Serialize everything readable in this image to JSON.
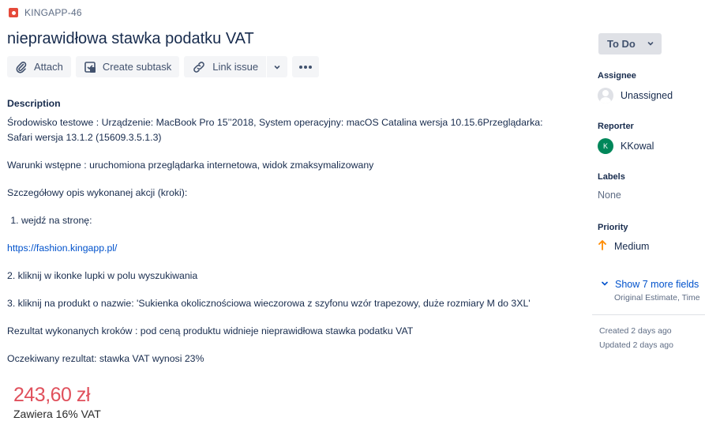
{
  "issue": {
    "key": "KINGAPP-46",
    "title": "nieprawidłowa stawka podatku VAT"
  },
  "toolbar": {
    "attach": "Attach",
    "create_subtask": "Create subtask",
    "link_issue": "Link issue"
  },
  "description": {
    "heading": "Description",
    "env_line1": "Środowisko testowe : Urządzenie: MacBook Pro 15’’2018, System operacyjny: macOS Catalina wersja 10.15.6Przeglądarka:",
    "env_line2": "Safari wersja 13.1.2 (15609.3.5.1.3)",
    "preconditions": "Warunki wstępne : uruchomiona przeglądarka internetowa, widok zmaksymalizowany",
    "steps_intro": "Szczegółowy opis wykonanej akcji (kroki):",
    "step1": "wejdź na stronę:",
    "link": "https://fashion.kingapp.pl/",
    "step2": "2. kliknij w ikonke lupki w polu wyszukiwania",
    "step3": "3. kliknij na produkt o nazwie: 'Sukienka okolicznościowa wieczorowa z szyfonu wzór trapezowy, duże rozmiary M do 3XL'",
    "result": "Rezultat wykonanych kroków : pod ceną produktu widnieje nieprawidłowa stawka podatku VAT",
    "expected": "Oczekiwany rezultat: stawka VAT wynosi 23%"
  },
  "attachment": {
    "price": "243,60 zł",
    "vat_note": "Zawiera 16% VAT"
  },
  "sidebar": {
    "status": "To Do",
    "assignee_label": "Assignee",
    "assignee_value": "Unassigned",
    "reporter_label": "Reporter",
    "reporter_initial": "K",
    "reporter_value": "KKowal",
    "labels_label": "Labels",
    "labels_value": "None",
    "priority_label": "Priority",
    "priority_value": "Medium",
    "show_more": "Show 7 more fields",
    "show_more_sub": "Original Estimate, Time",
    "created": "Created 2 days ago",
    "updated": "Updated 2 days ago"
  },
  "colors": {
    "link": "#0052CC",
    "bug": "#E5493A",
    "priority_medium": "#FF8B00",
    "reporter_avatar": "#00875A",
    "price": "#E0505C"
  },
  "icons": [
    "bug-icon",
    "paperclip-icon",
    "subtask-icon",
    "link-icon",
    "chevron-down-icon",
    "more-icon",
    "unassigned-avatar-icon",
    "priority-medium-icon",
    "chevron-down-icon"
  ]
}
